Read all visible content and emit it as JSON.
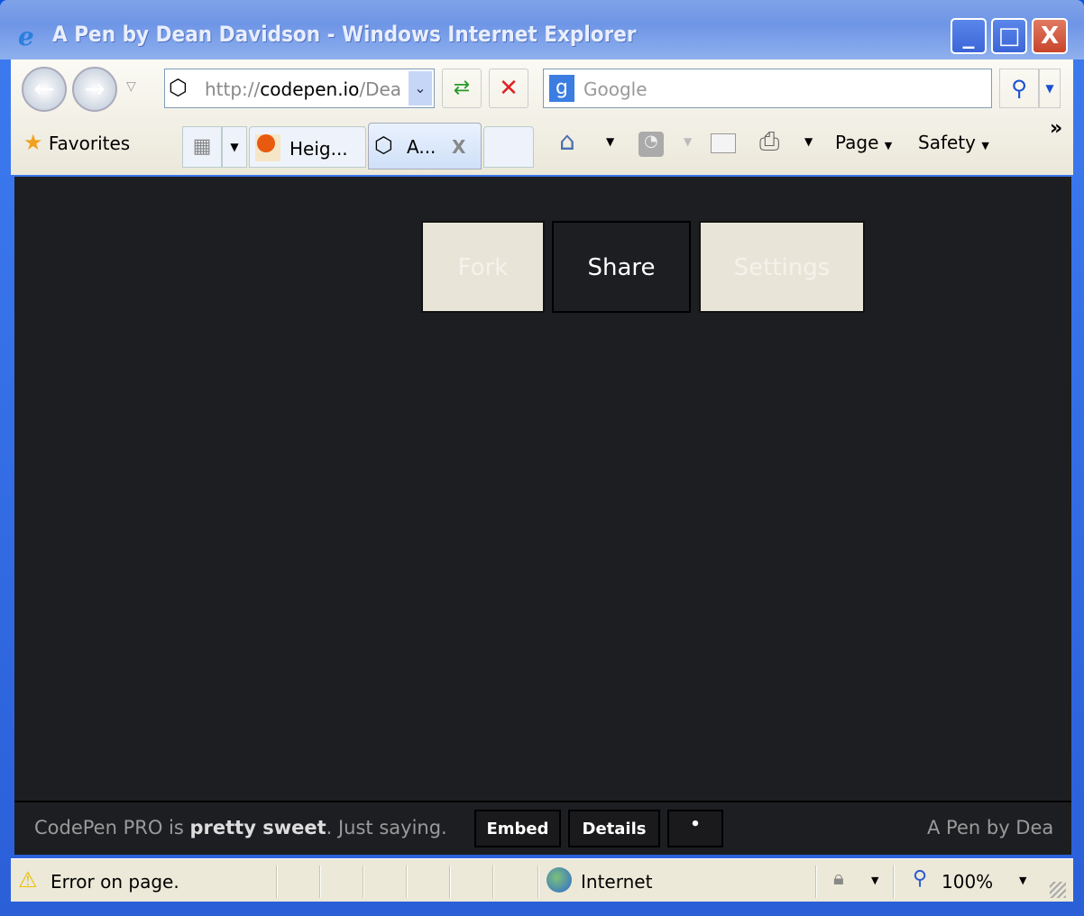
{
  "window": {
    "title": "A Pen by Dean Davidson - Windows Internet Explorer",
    "minimize": "_",
    "maximize": "□",
    "close": "X"
  },
  "toolbar": {
    "address_prefix": "http://",
    "address_host": "codepen.io",
    "address_rest": "/Dea",
    "search_placeholder": "Google",
    "favorites": "Favorites",
    "tabs": [
      {
        "label": "Heig..."
      },
      {
        "label": "A...",
        "close": "X"
      }
    ],
    "page": "Page",
    "safety": "Safety",
    "more": "»"
  },
  "page": {
    "buttons": [
      {
        "label": "Fork"
      },
      {
        "label": "Share"
      },
      {
        "label": "Settings"
      }
    ],
    "footer": {
      "promo_1": "CodePen PRO is ",
      "promo_2": "pretty sweet",
      "promo_3": ". Just saying.",
      "embed": "Embed",
      "details": "Details",
      "dot": "•",
      "attribution": "A Pen by Dea"
    }
  },
  "status": {
    "error": "Error on page.",
    "zone": "Internet",
    "zoom": "100%"
  }
}
